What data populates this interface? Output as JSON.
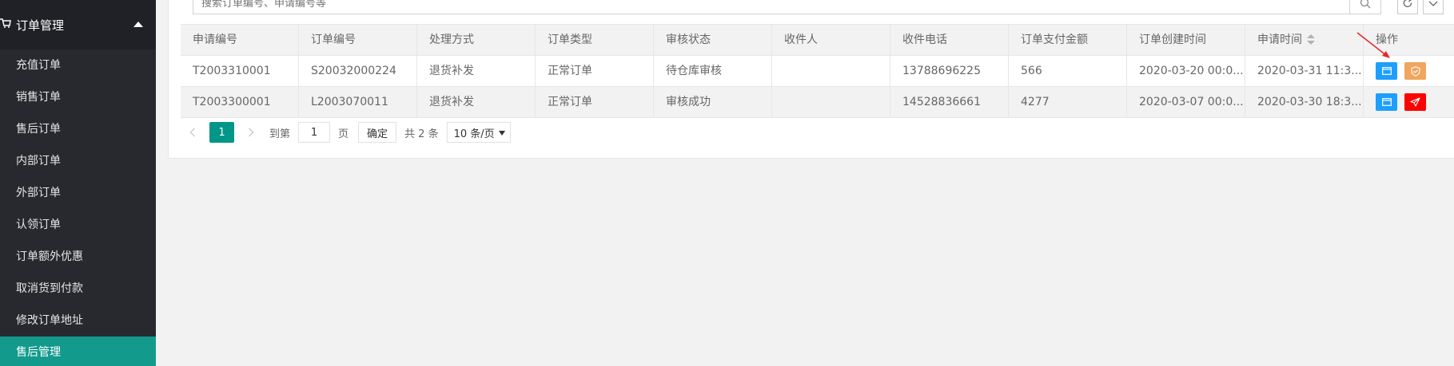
{
  "sidebar": {
    "group_title": "订单管理",
    "items": [
      {
        "label": "充值订单"
      },
      {
        "label": "销售订单"
      },
      {
        "label": "售后订单"
      },
      {
        "label": "内部订单"
      },
      {
        "label": "外部订单"
      },
      {
        "label": "认领订单"
      },
      {
        "label": "订单额外优惠"
      },
      {
        "label": "取消货到付款"
      },
      {
        "label": "修改订单地址"
      },
      {
        "label": "售后管理"
      }
    ],
    "active_item": "售后管理"
  },
  "search": {
    "placeholder": "搜索订单编号、申请编号等"
  },
  "table": {
    "headers": [
      "申请编号",
      "订单编号",
      "处理方式",
      "订单类型",
      "审核状态",
      "收件人",
      "收件电话",
      "订单支付金额",
      "订单创建时间",
      "申请时间",
      "操作"
    ],
    "sortable_column": "申请时间",
    "rows": [
      {
        "apply_no": "T2003310001",
        "order_no": "S20032000224",
        "method": "退货补发",
        "order_type": "正常订单",
        "status": "待仓库审核",
        "receiver": "",
        "phone": "13788696225",
        "amount": "566",
        "created": "2020-03-20 00:0...",
        "applied": "2020-03-31 11:3...",
        "actions": [
          "view-icon",
          "audit-shield-icon"
        ]
      },
      {
        "apply_no": "T2003300001",
        "order_no": "L2003070011",
        "method": "退货补发",
        "order_type": "正常订单",
        "status": "审核成功",
        "receiver": "",
        "phone": "14528836661",
        "amount": "4277",
        "created": "2020-03-07 00:0...",
        "applied": "2020-03-30 18:3...",
        "actions": [
          "view-icon",
          "send-icon"
        ]
      }
    ]
  },
  "pager": {
    "current": "1",
    "goto_label": "到第",
    "goto_value": "1",
    "page_unit": "页",
    "ok_label": "确定",
    "total": "共 2 条",
    "page_size": "10 条/页"
  },
  "colors": {
    "sidebar_bg": "#28292e",
    "active_item": "#129a8c",
    "view_button": "#1e9fff",
    "audit_button": "#f0a65e",
    "send_button": "#ff0000",
    "pager_current": "#009688",
    "annotation_arrow": "#e8252a"
  }
}
